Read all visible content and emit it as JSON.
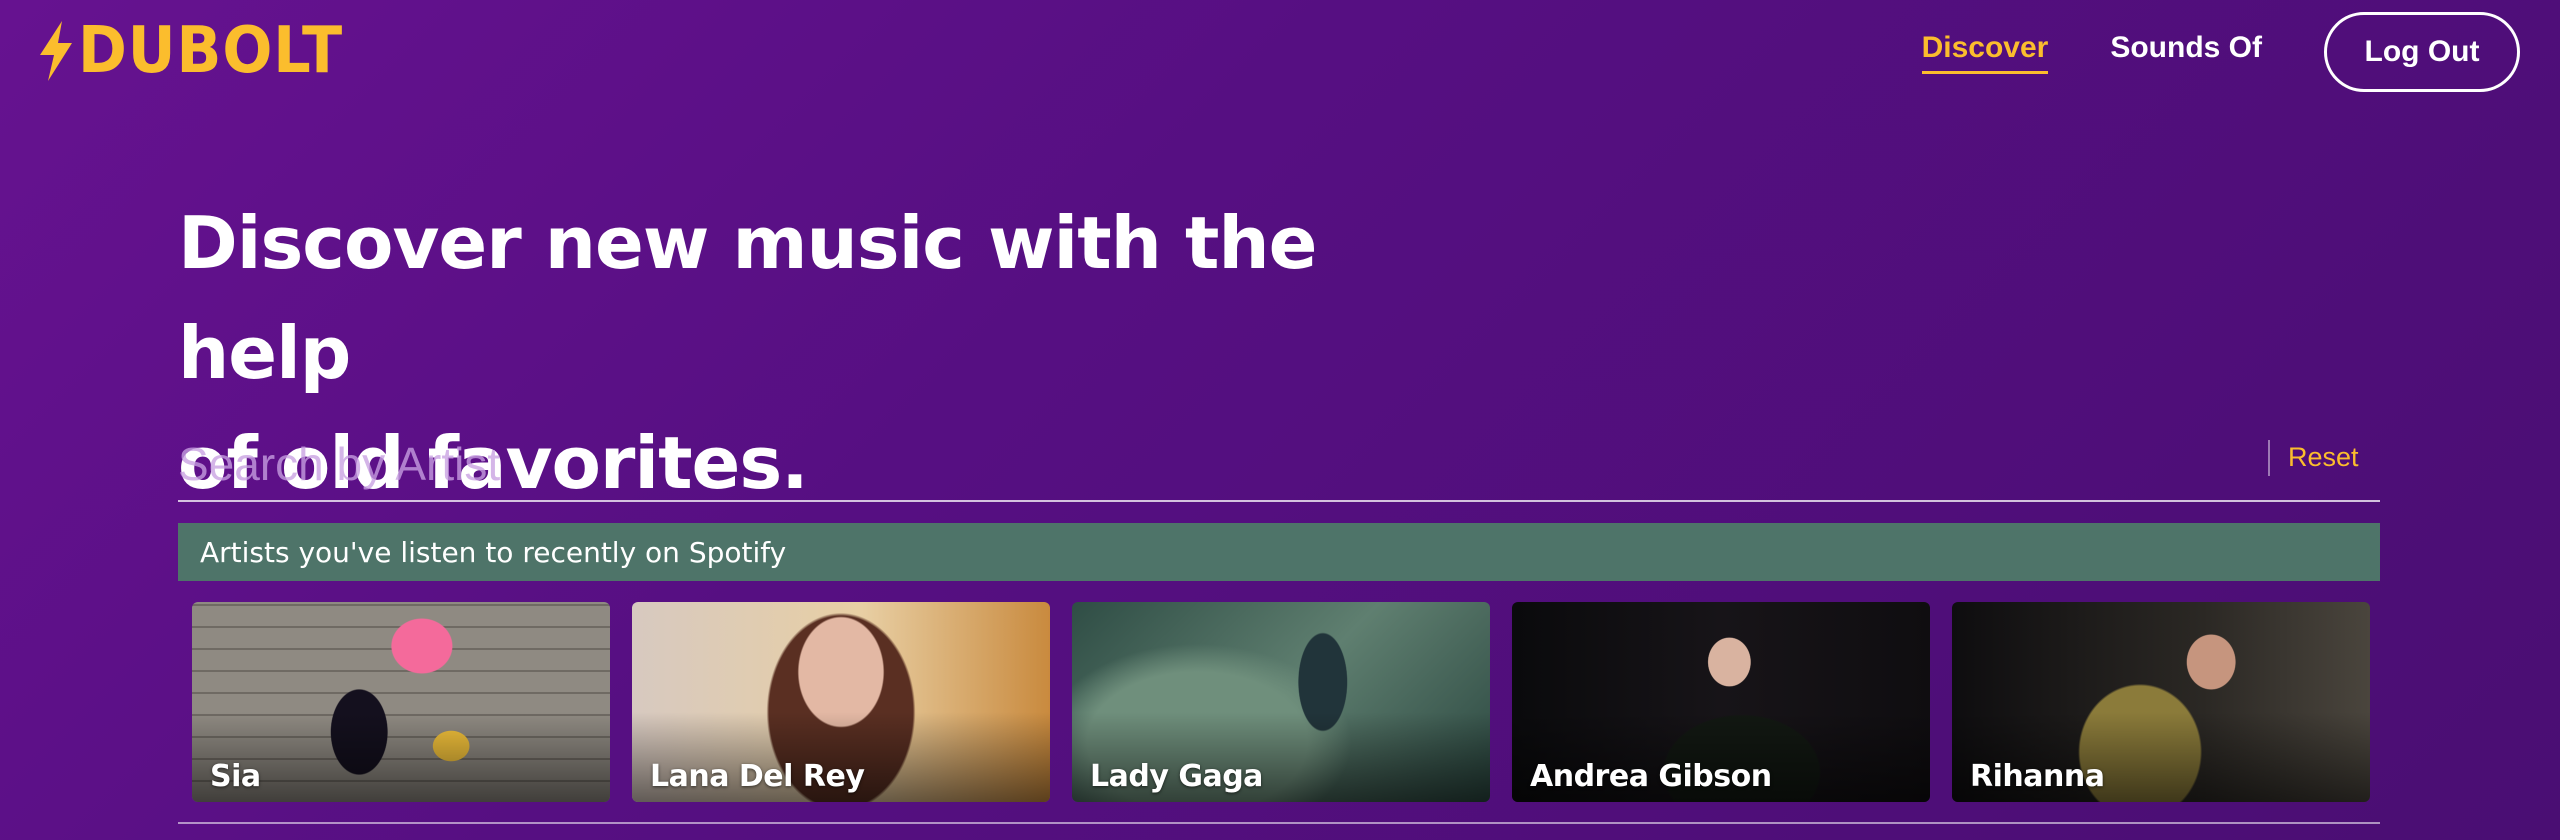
{
  "brand": {
    "name": "DUBOLT",
    "color": "#fbbd2d"
  },
  "nav": {
    "items": [
      {
        "label": "Discover",
        "active": true
      },
      {
        "label": "Sounds Of",
        "active": false
      }
    ],
    "logout_label": "Log Out"
  },
  "hero": {
    "line1": "Discover new music with the help",
    "line2": "of old favorites."
  },
  "search": {
    "placeholder": "Search by Artist",
    "value": "",
    "reset_label": "Reset"
  },
  "recent": {
    "title": "Artists you've listen to recently on Spotify",
    "artists": [
      {
        "name": "Sia"
      },
      {
        "name": "Lana Del Rey"
      },
      {
        "name": "Lady Gaga"
      },
      {
        "name": "Andrea Gibson"
      },
      {
        "name": "Rihanna"
      }
    ]
  },
  "colors": {
    "background": "#5a1085",
    "accent": "#fbbd2d",
    "recent_bar": "#4e7469"
  }
}
